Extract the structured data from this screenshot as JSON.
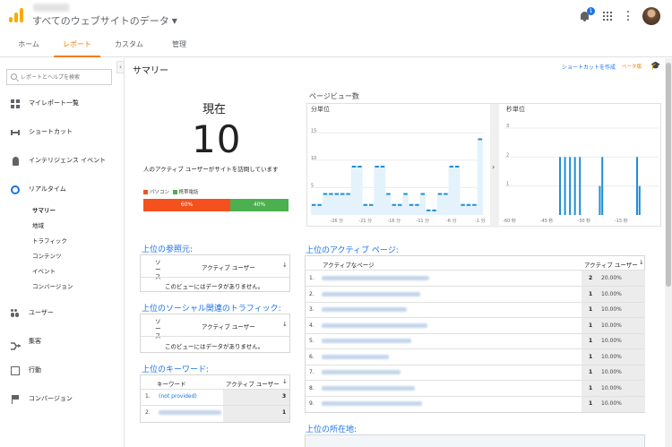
{
  "header": {
    "property_title": "すべてのウェブサイトのデータ",
    "notification_count": "1"
  },
  "tabs": [
    "ホーム",
    "レポート",
    "カスタム",
    "管理"
  ],
  "sidebar": {
    "search_placeholder": "レポートとヘルプを検索",
    "items": [
      {
        "label": "マイレポート一覧",
        "icon": "dashboard-grid-icon"
      },
      {
        "label": "ショートカット",
        "icon": "shortcut-icon"
      },
      {
        "label": "インテリジェンス イベント",
        "icon": "lightbulb-icon"
      },
      {
        "label": "リアルタイム",
        "icon": "realtime-icon"
      },
      {
        "label": "ユーザー",
        "icon": "users-icon"
      },
      {
        "label": "集客",
        "icon": "acquisition-icon"
      },
      {
        "label": "行動",
        "icon": "behavior-icon"
      },
      {
        "label": "コンバージョン",
        "icon": "flag-icon"
      }
    ],
    "realtime_sub": [
      "サマリー",
      "地域",
      "トラフィック",
      "コンテンツ",
      "イベント",
      "コンバージョン"
    ]
  },
  "summary": {
    "title": "サマリー",
    "shortcut_label": "ショートカットを作成",
    "beta_label": "ベータ版"
  },
  "now": {
    "label": "現在",
    "count": "10",
    "description": "人のアクティブ ユーザーがサイトを訪問しています",
    "devices": [
      {
        "label": "パソコン",
        "percent": "60%",
        "value": 60,
        "color": "#f4511e"
      },
      {
        "label": "携帯電話",
        "percent": "40%",
        "value": 40,
        "color": "#4caf50"
      }
    ]
  },
  "referrers": {
    "title": "上位の参照元:",
    "col_source": "ソース",
    "col_users": "アクティブ ユーザー",
    "empty": "このビューにはデータがありません。"
  },
  "social": {
    "title": "上位のソーシャル関連のトラフィック:",
    "col_source": "ソース",
    "col_users": "アクティブ ユーザー",
    "empty": "このビューにはデータがありません。"
  },
  "keywords": {
    "title": "上位のキーワード:",
    "col_keyword": "キーワード",
    "col_users": "アクティブ ユーザー",
    "rows": [
      {
        "num": "1.",
        "keyword": "(not provided)",
        "users": "3"
      },
      {
        "num": "2.",
        "keyword": "",
        "users": "1"
      }
    ]
  },
  "pageviews": {
    "title": "ページビュー数",
    "per_minute_label": "分単位",
    "per_second_label": "秒単位"
  },
  "chart_data": [
    {
      "type": "bar",
      "title": "分単位",
      "y_ticks": [
        "15",
        "10",
        "5"
      ],
      "x_ticks": [
        "-26 分",
        "-21 分",
        "-16 分",
        "-11 分",
        "-6 分",
        "-1 分"
      ],
      "x": [
        -30,
        -29,
        -28,
        -27,
        -26,
        -25,
        -24,
        -23,
        -22,
        -21,
        -20,
        -19,
        -18,
        -17,
        -16,
        -15,
        -14,
        -13,
        -12,
        -11,
        -10,
        -9,
        -8,
        -7,
        -6,
        -5,
        -4,
        -3,
        -2,
        -1
      ],
      "values": [
        2,
        2,
        4,
        4,
        4,
        4,
        4,
        9,
        9,
        2,
        2,
        9,
        9,
        4,
        2,
        2,
        4,
        2,
        2,
        4,
        1,
        1,
        4,
        4,
        9,
        9,
        2,
        2,
        2,
        14
      ]
    },
    {
      "type": "bar",
      "title": "秒単位",
      "y_ticks": [
        "3",
        "2",
        "1"
      ],
      "x_ticks": [
        "-60 秒",
        "-45 秒",
        "-30 秒",
        "-15 秒"
      ],
      "x": [
        -40,
        -38,
        -36,
        -34,
        -32,
        -24,
        -23,
        -9,
        -8
      ],
      "values": [
        2,
        2,
        2,
        2,
        2,
        1,
        2,
        2,
        1
      ]
    }
  ],
  "top_pages": {
    "title": "上位のアクティブ ページ:",
    "col_page": "アクティブなページ",
    "col_users": "アクティブ ユーザー",
    "rows": [
      {
        "num": "1.",
        "users": "2",
        "pct": "20.00%",
        "share": 20
      },
      {
        "num": "2.",
        "users": "1",
        "pct": "10.00%",
        "share": 10
      },
      {
        "num": "3.",
        "users": "1",
        "pct": "10.00%",
        "share": 10
      },
      {
        "num": "4.",
        "users": "1",
        "pct": "10.00%",
        "share": 10
      },
      {
        "num": "5.",
        "users": "1",
        "pct": "10.00%",
        "share": 10
      },
      {
        "num": "6.",
        "users": "1",
        "pct": "10.00%",
        "share": 10
      },
      {
        "num": "7.",
        "users": "1",
        "pct": "10.00%",
        "share": 10
      },
      {
        "num": "8.",
        "users": "1",
        "pct": "10.00%",
        "share": 10
      },
      {
        "num": "9.",
        "users": "1",
        "pct": "10.00%",
        "share": 10
      }
    ]
  },
  "locations": {
    "title": "上位の所在地:"
  },
  "colors": {
    "accent": "#f57c00",
    "link": "#1a73e8",
    "bar": "#1f8dd6",
    "bar_fill": "#e3f2fb"
  }
}
